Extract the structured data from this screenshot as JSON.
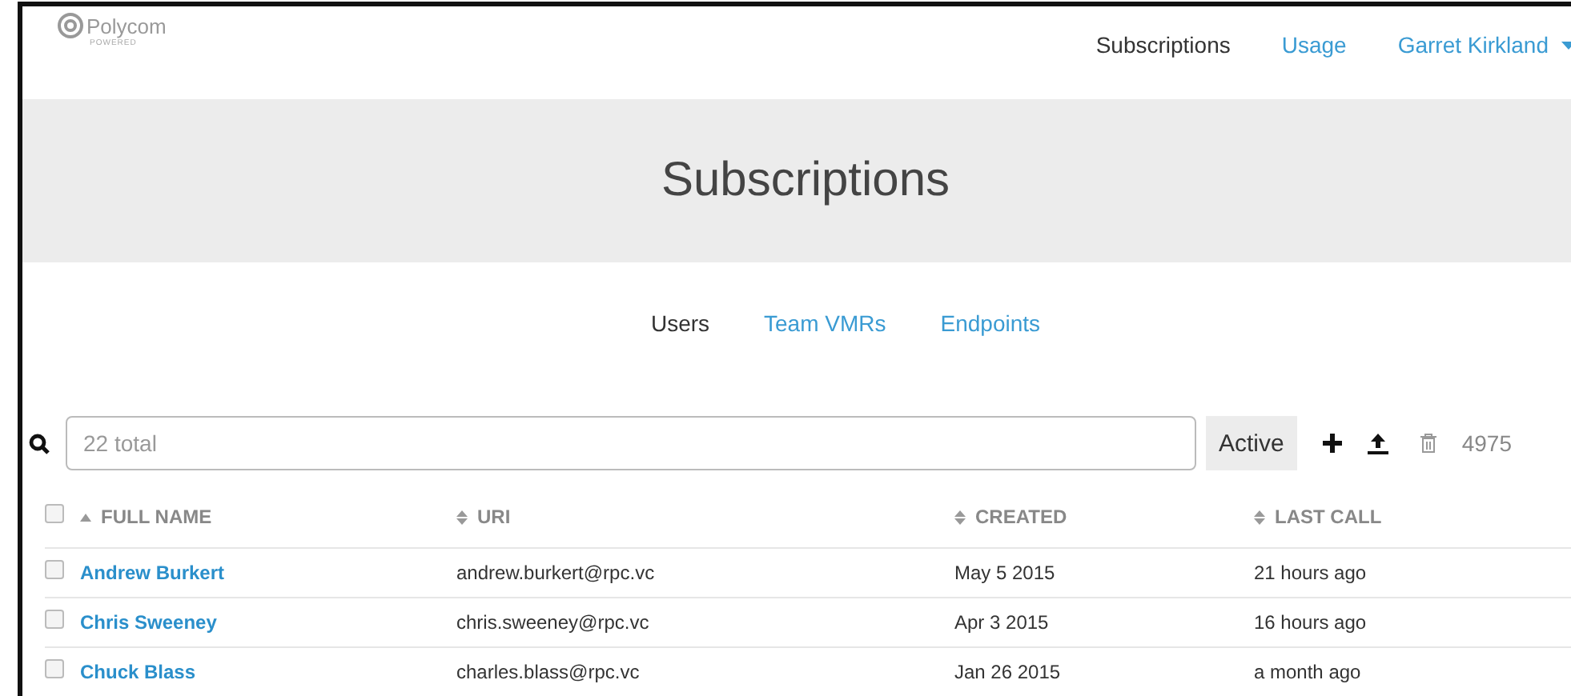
{
  "logo": {
    "name": "Polycom",
    "tagline": "POWERED"
  },
  "nav": [
    {
      "label": "Subscriptions",
      "selected": true
    },
    {
      "label": "Usage",
      "selected": false
    },
    {
      "label": "Garret Kirkland",
      "selected": false,
      "kind": "dropdown"
    }
  ],
  "banner": {
    "title": "Subscriptions"
  },
  "tabs": [
    {
      "label": "Users",
      "selected": true
    },
    {
      "label": "Team VMRs",
      "selected": false
    },
    {
      "label": "Endpoints",
      "selected": false
    }
  ],
  "search": {
    "placeholder": "22 total"
  },
  "filter": {
    "label": "Active"
  },
  "count": "4975",
  "table": {
    "select_all": {
      "checked": false
    },
    "columns": [
      {
        "label": "FULL NAME",
        "sorted": true
      },
      {
        "label": "URI",
        "sorted": false
      },
      {
        "label": "CREATED",
        "sorted": false
      },
      {
        "label": "LAST CALL",
        "sorted": false
      }
    ],
    "rows": [
      {
        "checked": false,
        "cells": [
          "Andrew Burkert",
          "andrew.burkert@rpc.vc",
          "May 5 2015",
          "21 hours ago"
        ]
      },
      {
        "checked": false,
        "cells": [
          "Chris Sweeney",
          "chris.sweeney@rpc.vc",
          "Apr 3 2015",
          "16 hours ago"
        ]
      },
      {
        "checked": false,
        "cells": [
          "Chuck Blass",
          "charles.blass@rpc.vc",
          "Jan 26 2015",
          "a month ago"
        ]
      }
    ]
  }
}
